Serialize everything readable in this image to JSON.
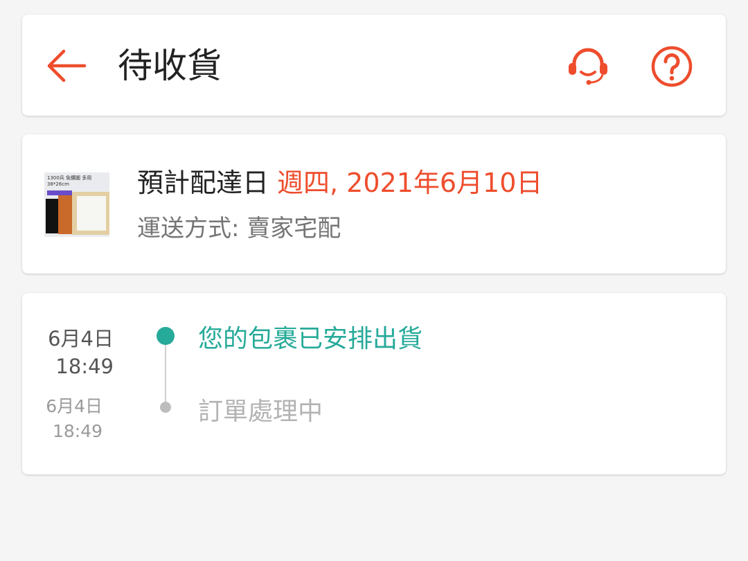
{
  "header": {
    "title": "待收貨",
    "back_icon": "arrow-left-icon",
    "support_icon": "headset-icon",
    "help_icon": "question-circle-icon",
    "accent_color": "#ee4d2d"
  },
  "delivery": {
    "eta_label": "預計配達日",
    "eta_date": "週四, 2021年6月10日",
    "shipping": "運送方式: 賣家宅配",
    "thumbnail_text": "1300兵 免鑽圖 多用 38*26cm"
  },
  "tracking": {
    "events": [
      {
        "date": "6月4日",
        "time": "18:49",
        "status": "您的包裹已安排出貨",
        "active": true
      },
      {
        "date": "6月4日",
        "time": "18:49",
        "status": "訂單處理中",
        "active": false
      }
    ],
    "active_color": "#26aa99"
  }
}
